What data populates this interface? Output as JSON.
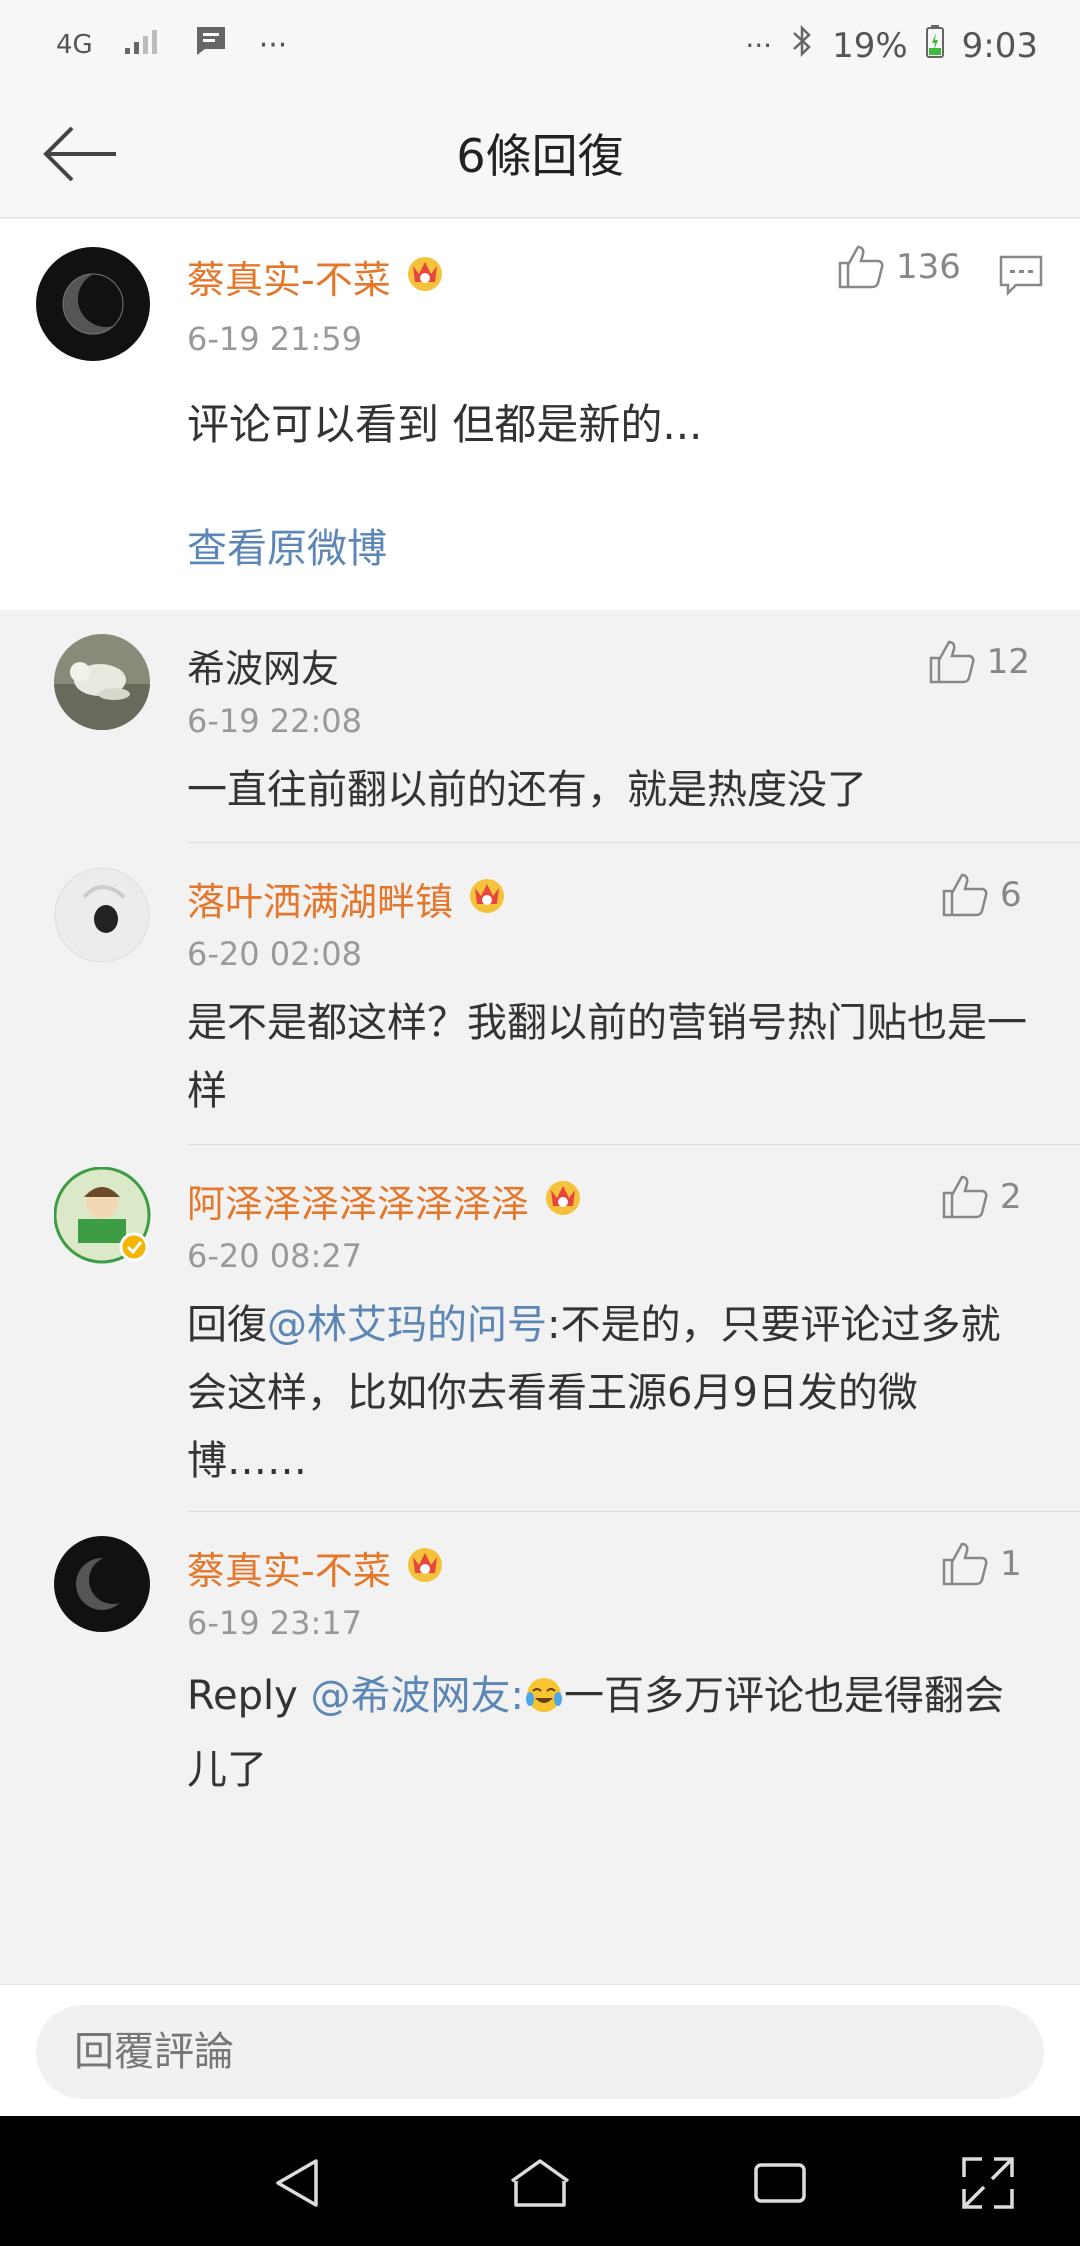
{
  "status_bar": {
    "network": "4G",
    "dots_left": "···",
    "dots_right": "···",
    "battery": "19%",
    "time": "9:03"
  },
  "header": {
    "title": "6條回復"
  },
  "root_comment": {
    "author": "蔡真实-不菜",
    "time": "6-19 21:59",
    "text": "评论可以看到 但都是新的...",
    "likes": "136",
    "view_original": "查看原微博"
  },
  "replies": [
    {
      "author": "希波网友",
      "time": "6-19 22:08",
      "text": "一直往前翻以前的还有，就是热度没了",
      "likes": "12"
    },
    {
      "author": "落叶洒满湖畔镇",
      "time": "6-20 02:08",
      "text": "是不是都这样？我翻以前的营销号热门贴也是一样",
      "likes": "6"
    },
    {
      "author": "阿泽泽泽泽泽泽泽泽",
      "time": "6-20 08:27",
      "prefix": "回復",
      "mention": "@林艾玛的问号",
      "text": ":不是的，只要评论过多就会这样，比如你去看看王源6月9日发的微博……",
      "likes": "2"
    },
    {
      "author": "蔡真实-不菜",
      "time": "6-19 23:17",
      "prefix": "Reply ",
      "mention": "@希波网友",
      "text_after_emoji": "一百多万评论也是得翻会儿了",
      "colon": ":",
      "likes": "1"
    }
  ],
  "reply_bar": {
    "placeholder": "回覆評論"
  },
  "colors": {
    "name_orange": "#e5772a",
    "link_blue": "#5b86b5",
    "background": "#f2f2f2"
  }
}
